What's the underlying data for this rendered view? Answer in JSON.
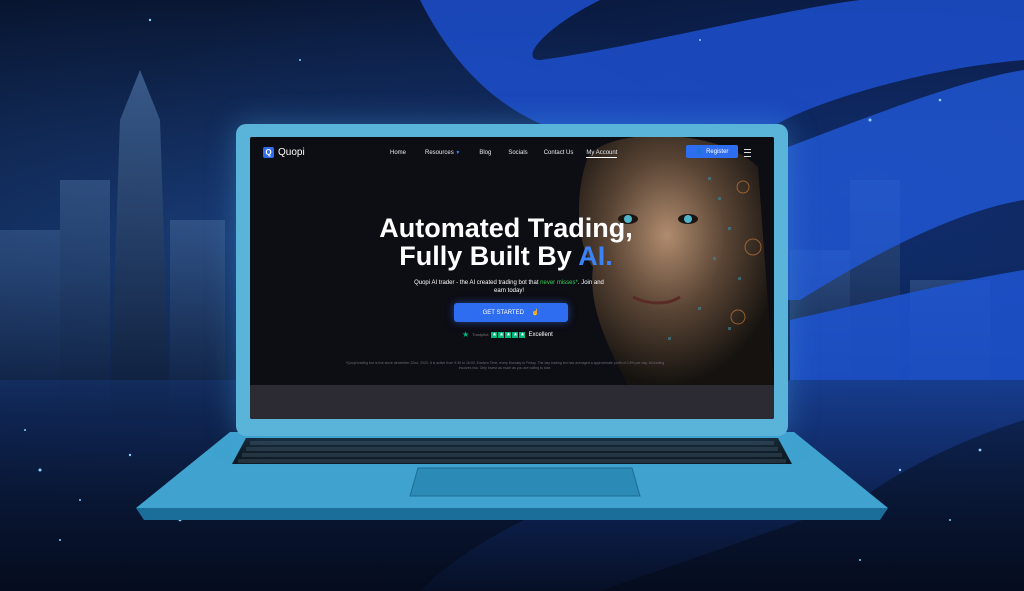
{
  "site": {
    "brand": "Quopi",
    "nav": [
      "Home",
      "Resources",
      "Blog",
      "Socials",
      "Contact Us",
      "My Account"
    ],
    "register_label": "Register"
  },
  "hero": {
    "title_line1": "Automated Trading,",
    "title_line2_pre": "Fully Built By ",
    "title_line2_ai": "AI.",
    "subtitle_pre": "Quopi AI trader - the AI created trading bot that ",
    "subtitle_highlight": "never misses*",
    "subtitle_post": ". Join and earn today!",
    "cta_label": "GET STARTED",
    "trust_brand": "Trustpilot",
    "trust_rating": "Excellent",
    "disclaimer": "*Quopi trading bot is live since december 22nd, 2023. It is active from 9:30 to 16:00, Eastern Time, every Monday to Friday. The day trading bot has averaged a approximate profit of 2.8% per day. All trading involves risk. Only invest as much as you are willing to lose."
  },
  "colors": {
    "accent": "#2f6df0",
    "highlight": "#39d353",
    "trustpilot": "#00b67a",
    "laptop_body": "#5ab3d9"
  }
}
